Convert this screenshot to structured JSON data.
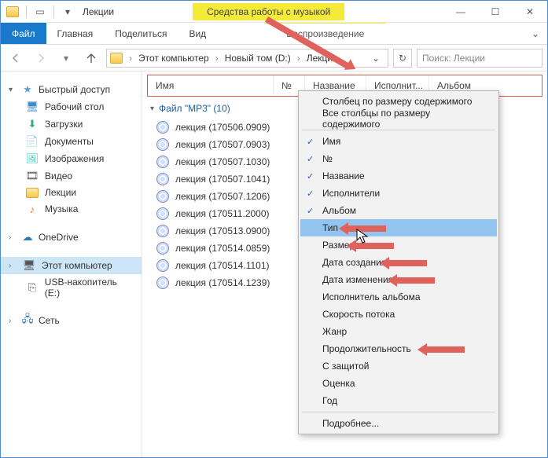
{
  "title": "Лекции",
  "context_tools": "Средства работы с музыкой",
  "ribbon": {
    "file": "Файл",
    "home": "Главная",
    "share": "Поделиться",
    "view": "Вид",
    "play": "Воспроизведение"
  },
  "breadcrumb": {
    "this_pc": "Этот компьютер",
    "drive": "Новый том (D:)",
    "folder": "Лекции"
  },
  "search_placeholder": "Поиск: Лекции",
  "nav": {
    "quick_access": "Быстрый доступ",
    "items_qa": [
      {
        "icon": "desktop",
        "label": "Рабочий стол"
      },
      {
        "icon": "down",
        "label": "Загрузки"
      },
      {
        "icon": "docs",
        "label": "Документы"
      },
      {
        "icon": "img",
        "label": "Изображения"
      },
      {
        "icon": "video",
        "label": "Видео"
      },
      {
        "icon": "folder",
        "label": "Лекции"
      },
      {
        "icon": "music",
        "label": "Музыка"
      }
    ],
    "onedrive": "OneDrive",
    "this_pc": "Этот компьютер",
    "usb": "USB-накопитель (E:)",
    "network": "Сеть"
  },
  "columns": {
    "name": "Имя",
    "num": "№",
    "title": "Название",
    "artist": "Исполнит...",
    "album": "Альбом"
  },
  "group_header": "Файл \"MP3\" (10)",
  "files": [
    "лекция (170506.0909)",
    "лекция (170507.0903)",
    "лекция (170507.1030)",
    "лекция (170507.1041)",
    "лекция (170507.1206)",
    "лекция (170511.2000)",
    "лекция (170513.0900)",
    "лекция (170514.0859)",
    "лекция (170514.1101)",
    "лекция (170514.1239)"
  ],
  "menu": {
    "size_to_fit": "Столбец по размеру содержимого",
    "all_size_to_fit": "Все столбцы по размеру содержимого",
    "cols": [
      {
        "label": "Имя",
        "checked": true
      },
      {
        "label": "№",
        "checked": true
      },
      {
        "label": "Название",
        "checked": true
      },
      {
        "label": "Исполнители",
        "checked": true
      },
      {
        "label": "Альбом",
        "checked": true
      },
      {
        "label": "Тип",
        "checked": false,
        "highlight": true
      },
      {
        "label": "Размер",
        "checked": false
      },
      {
        "label": "Дата создания",
        "checked": false
      },
      {
        "label": "Дата изменения",
        "checked": false
      },
      {
        "label": "Исполнитель альбома",
        "checked": false
      },
      {
        "label": "Скорость потока",
        "checked": false
      },
      {
        "label": "Жанр",
        "checked": false
      },
      {
        "label": "Продолжительность",
        "checked": false
      },
      {
        "label": "С защитой",
        "checked": false
      },
      {
        "label": "Оценка",
        "checked": false
      },
      {
        "label": "Год",
        "checked": false
      }
    ],
    "more": "Подробнее..."
  }
}
